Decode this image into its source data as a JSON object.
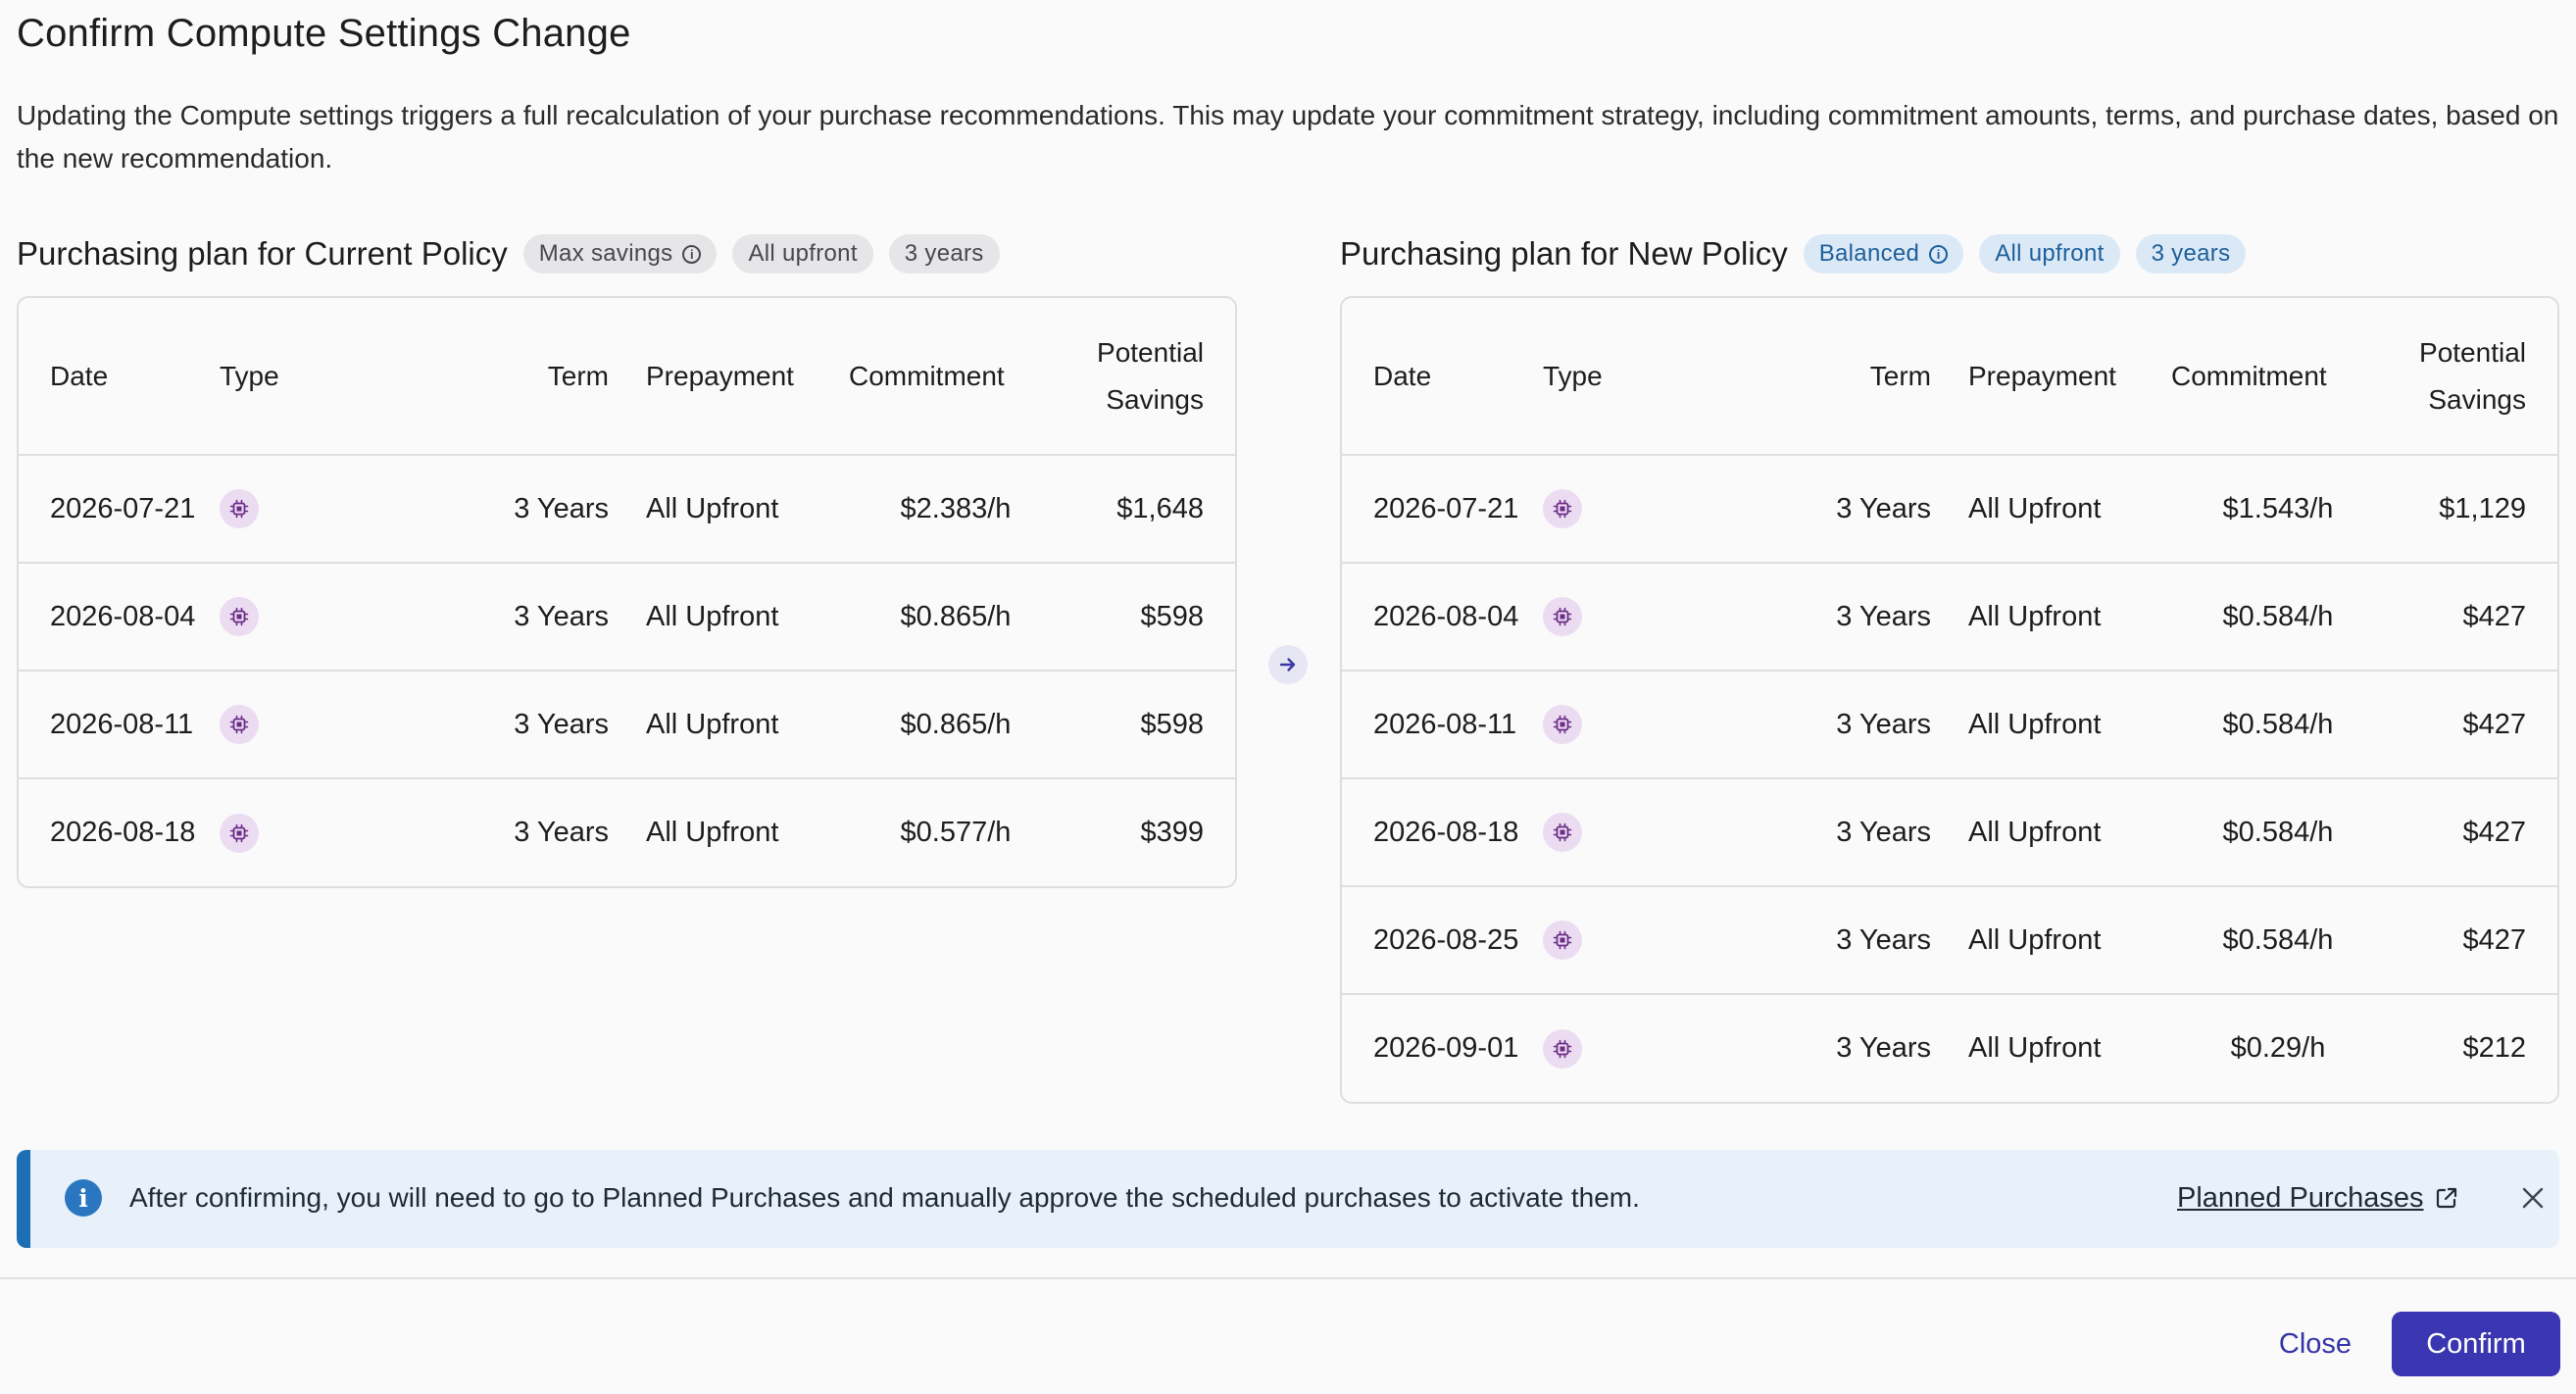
{
  "dialog": {
    "title": "Confirm Compute Settings Change",
    "description": "Updating the Compute settings triggers a full recalculation of your purchase recommendations. This may update your commitment strategy, including commitment amounts, terms, and purchase dates, based on the new recommendation."
  },
  "columns": {
    "date": "Date",
    "type": "Type",
    "term": "Term",
    "prepayment": "Prepayment",
    "commitment": "Commitment",
    "savings_line1": "Potential",
    "savings_line2": "Savings"
  },
  "current_plan": {
    "title": "Purchasing plan for Current Policy",
    "tags": [
      "Max savings",
      "All upfront",
      "3 years"
    ],
    "rows": [
      {
        "date": "2026-07-21",
        "type_icon": "cpu-chip-icon",
        "term": "3 Years",
        "prepayment": "All Upfront",
        "commitment": "$2.383/h",
        "savings": "$1,648"
      },
      {
        "date": "2026-08-04",
        "type_icon": "cpu-chip-icon",
        "term": "3 Years",
        "prepayment": "All Upfront",
        "commitment": "$0.865/h",
        "savings": "$598"
      },
      {
        "date": "2026-08-11",
        "type_icon": "cpu-chip-icon",
        "term": "3 Years",
        "prepayment": "All Upfront",
        "commitment": "$0.865/h",
        "savings": "$598"
      },
      {
        "date": "2026-08-18",
        "type_icon": "cpu-chip-icon",
        "term": "3 Years",
        "prepayment": "All Upfront",
        "commitment": "$0.577/h",
        "savings": "$399"
      }
    ]
  },
  "new_plan": {
    "title": "Purchasing plan for New Policy",
    "tags": [
      "Balanced",
      "All upfront",
      "3 years"
    ],
    "rows": [
      {
        "date": "2026-07-21",
        "type_icon": "cpu-chip-icon",
        "term": "3 Years",
        "prepayment": "All Upfront",
        "commitment": "$1.543/h",
        "savings": "$1,129"
      },
      {
        "date": "2026-08-04",
        "type_icon": "cpu-chip-icon",
        "term": "3 Years",
        "prepayment": "All Upfront",
        "commitment": "$0.584/h",
        "savings": "$427"
      },
      {
        "date": "2026-08-11",
        "type_icon": "cpu-chip-icon",
        "term": "3 Years",
        "prepayment": "All Upfront",
        "commitment": "$0.584/h",
        "savings": "$427"
      },
      {
        "date": "2026-08-18",
        "type_icon": "cpu-chip-icon",
        "term": "3 Years",
        "prepayment": "All Upfront",
        "commitment": "$0.584/h",
        "savings": "$427"
      },
      {
        "date": "2026-08-25",
        "type_icon": "cpu-chip-icon",
        "term": "3 Years",
        "prepayment": "All Upfront",
        "commitment": "$0.584/h",
        "savings": "$427"
      },
      {
        "date": "2026-09-01",
        "type_icon": "cpu-chip-icon",
        "term": "3 Years",
        "prepayment": "All Upfront",
        "commitment": "$0.29/h",
        "savings": "$212"
      }
    ]
  },
  "banner": {
    "text": "After confirming, you will need to go to Planned Purchases and manually approve the scheduled purchases to activate them.",
    "link_label": "Planned Purchases"
  },
  "footer": {
    "close_label": "Close",
    "confirm_label": "Confirm"
  },
  "colors": {
    "accent": "#3a35b0",
    "info_bar": "#1e6eb6",
    "info_bg": "#e8f1fa",
    "chip_bg": "#ecdcf2",
    "chip_fg": "#6b2d86"
  }
}
